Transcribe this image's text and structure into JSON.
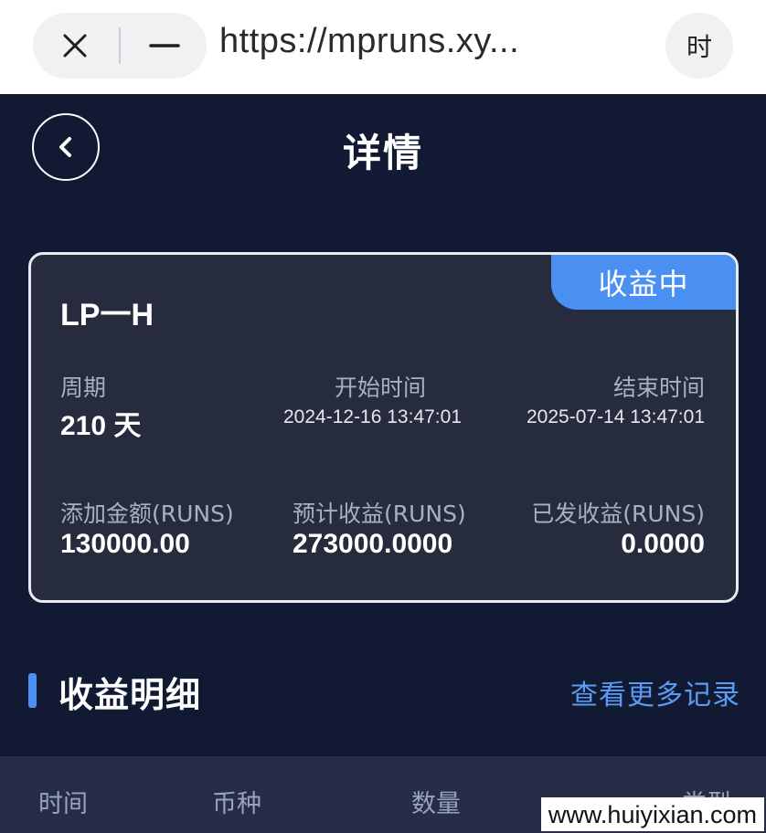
{
  "browser": {
    "url": "https://mpruns.xy...",
    "right_button": "时"
  },
  "header": {
    "title": "详情"
  },
  "card": {
    "product_name": "LP一H",
    "status": "收益中",
    "period_label": "周期",
    "period_value": "210 天",
    "start_label": "开始时间",
    "start_value": "2024-12-16 13:47:01",
    "end_label": "结束时间",
    "end_value": "2025-07-14 13:47:01",
    "added_label": "添加金额(RUNS)",
    "added_value": "130000.00",
    "expected_label": "预计收益(RUNS)",
    "expected_value": "273000.0000",
    "paid_label": "已发收益(RUNS)",
    "paid_value": "0.0000"
  },
  "section": {
    "title": "收益明细",
    "more_link": "查看更多记录"
  },
  "table": {
    "columns": [
      "时间",
      "币种",
      "数量",
      "类型"
    ]
  },
  "watermark": "www.huiyixian.com",
  "colors": {
    "background": "#121a33",
    "card": "#262b3d",
    "accent": "#4a8ff2",
    "link": "#5a9cf5"
  }
}
